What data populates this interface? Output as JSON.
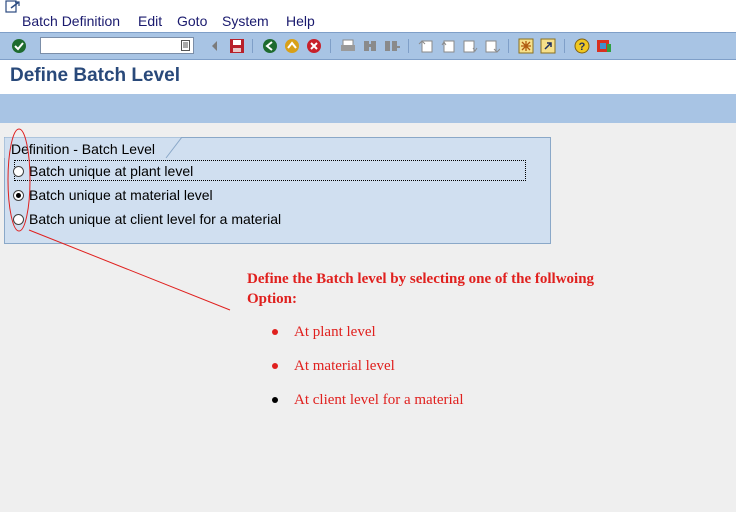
{
  "menu": {
    "items": [
      {
        "label": "Batch Definition"
      },
      {
        "label": "Edit"
      },
      {
        "label": "Goto"
      },
      {
        "label": "System"
      },
      {
        "label": "Help"
      }
    ]
  },
  "toolbar": {
    "command_value": "",
    "icons": [
      "check-icon",
      "back-nav-icon",
      "save-icon",
      "back-icon",
      "exit-icon",
      "cancel-icon",
      "print-icon",
      "find-icon",
      "find-next-icon",
      "first-page-icon",
      "previous-page-icon",
      "next-page-icon",
      "last-page-icon",
      "new-session-icon",
      "shortcut-icon",
      "help-icon",
      "layout-icon"
    ]
  },
  "page": {
    "title": "Define Batch Level"
  },
  "group": {
    "title": "Definition - Batch Level",
    "options": [
      {
        "label": "Batch unique at plant level",
        "selected": false
      },
      {
        "label": "Batch unique at material level",
        "selected": true
      },
      {
        "label": "Batch unique at client level for a material",
        "selected": false
      }
    ]
  },
  "annotation": {
    "heading": "Define the Batch level by selecting one of the follwoing Option:",
    "bullets": [
      {
        "text": "At plant level",
        "dot_color": "#e0201e"
      },
      {
        "text": "At material level",
        "dot_color": "#e0201e"
      },
      {
        "text": "At client level for a material",
        "dot_color": "#000000"
      }
    ]
  },
  "colors": {
    "accent": "#a8c4e4",
    "title": "#29497a",
    "annotation": "#e0201e",
    "group_bg": "#d0dff0"
  }
}
